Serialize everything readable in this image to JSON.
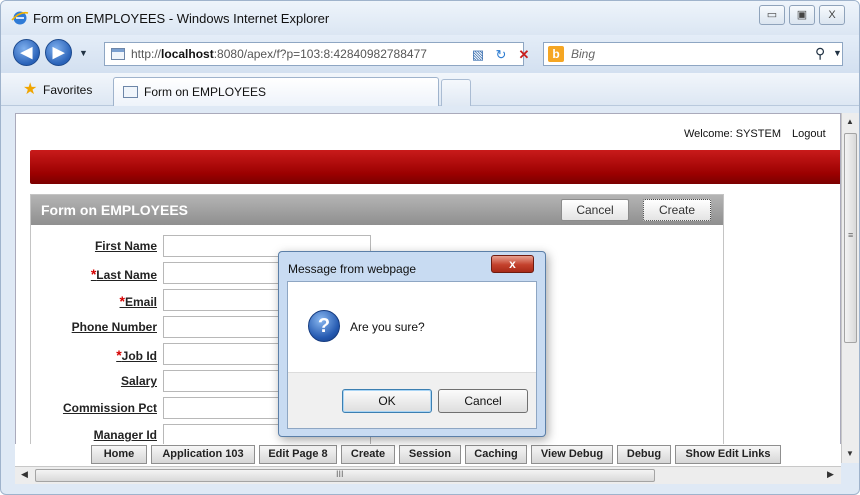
{
  "window": {
    "title": "Form on EMPLOYEES - Windows Internet Explorer",
    "controls": {
      "minimize": "▭",
      "maximize": "▣",
      "close": "X"
    }
  },
  "nav": {
    "address": {
      "host": "localhost",
      "prefix": "http://",
      "rest": ":8080/apex/f?p=103:8:42840982788477"
    },
    "search_placeholder": "Bing",
    "bing_letter": "b"
  },
  "favorites": {
    "label": "Favorites",
    "tab_label": "Form on EMPLOYEES"
  },
  "page": {
    "welcome": "Welcome: SYSTEM",
    "logout": "Logout",
    "region_title": "Form on EMPLOYEES",
    "cancel_label": "Cancel",
    "create_label": "Create",
    "fields": [
      {
        "label": "First Name",
        "required": false
      },
      {
        "label": "Last Name",
        "required": true
      },
      {
        "label": "Email",
        "required": true
      },
      {
        "label": "Phone Number",
        "required": false
      },
      {
        "label": "Job Id",
        "required": true
      },
      {
        "label": "Salary",
        "required": false
      },
      {
        "label": "Commission Pct",
        "required": false
      },
      {
        "label": "Manager Id",
        "required": false
      }
    ],
    "required_marker": "*"
  },
  "devbar": [
    "Home",
    "Application 103",
    "Edit Page 8",
    "Create",
    "Session",
    "Caching",
    "View Debug",
    "Debug",
    "Show Edit Links"
  ],
  "dialog": {
    "title": "Message from webpage",
    "close": "x",
    "message": "Are you sure?",
    "icon_glyph": "?",
    "ok": "OK",
    "cancel": "Cancel"
  },
  "scroll": {
    "grip": "III",
    "vgrip": "≡"
  },
  "colors": {
    "banner": "#b00000",
    "region_header": "#a0a0a0",
    "dialog_frame": "#c8dbf2"
  }
}
